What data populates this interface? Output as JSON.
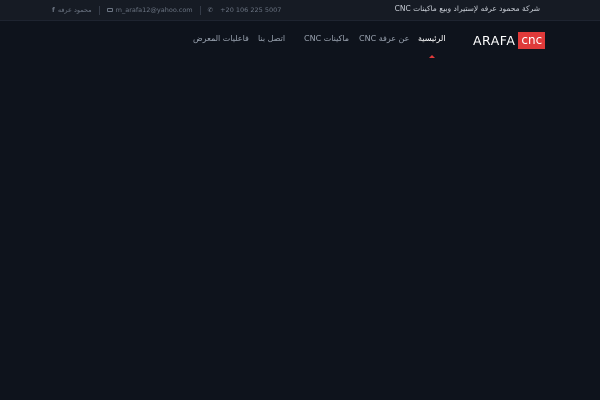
{
  "topbar": {
    "company_name": "شركة محمود عرفه لإستيراد وبيع ماكينات CNC",
    "phone": "+20 106 225 5007",
    "email": "m_arafa12@yahoo.com",
    "social_name": "محمود عرفه"
  },
  "logo": {
    "word": "ARAFA",
    "badge": "cnc",
    "badge_color": "#e03a3a"
  },
  "nav": {
    "items": [
      {
        "label": "الرئيسية",
        "active": true
      },
      {
        "label": "عن عرفة CNC",
        "active": false
      },
      {
        "label": "ماكينات CNC",
        "active": false
      },
      {
        "label": "اتصل بنا",
        "active": false
      },
      {
        "label": "فاعليات المعرض",
        "active": false
      }
    ]
  },
  "colors": {
    "background": "#0e131c",
    "topbar": "#161b24",
    "accent": "#e03a3a"
  }
}
